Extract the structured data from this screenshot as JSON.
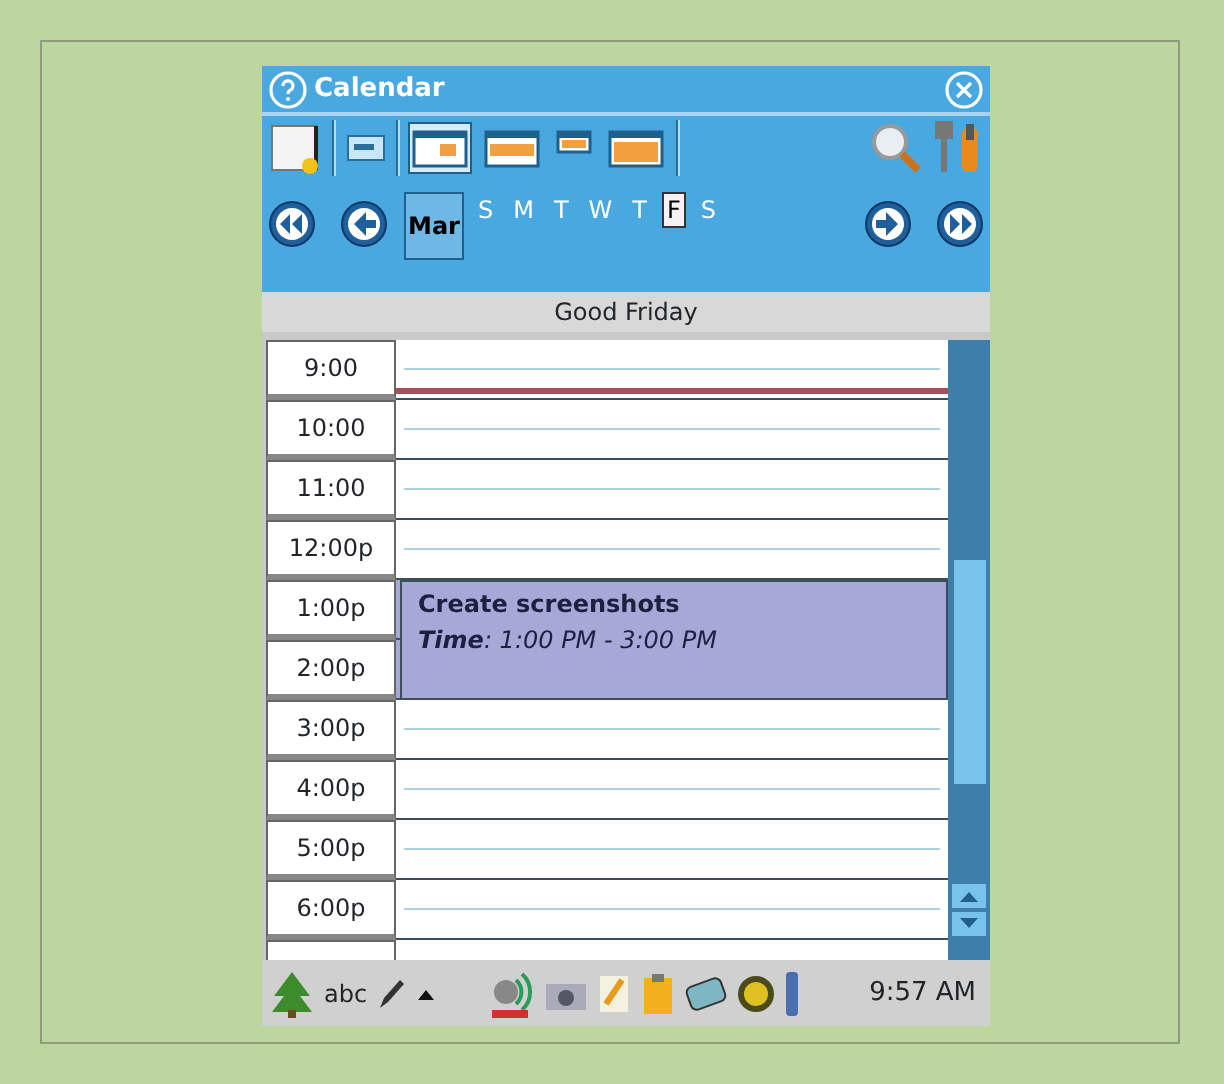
{
  "window": {
    "title": "Calendar"
  },
  "view_buttons": [
    {
      "selected": true
    },
    {
      "selected": false
    },
    {
      "selected": false
    },
    {
      "selected": false
    }
  ],
  "nav": {
    "month": {
      "label": "Mar",
      "selected": true
    },
    "days": [
      {
        "label": "S",
        "selected": false
      },
      {
        "label": "M",
        "selected": false
      },
      {
        "label": "T",
        "selected": false
      },
      {
        "label": "W",
        "selected": false
      },
      {
        "label": "T",
        "selected": false
      },
      {
        "label": "F",
        "selected": true
      },
      {
        "label": "S",
        "selected": false
      }
    ]
  },
  "day_header": "Good Friday",
  "hours": [
    {
      "label": "9:00",
      "busy": false,
      "current_time": true
    },
    {
      "label": "10:00",
      "busy": false,
      "current_time": false
    },
    {
      "label": "11:00",
      "busy": false,
      "current_time": false
    },
    {
      "label": "12:00p",
      "busy": false,
      "current_time": false
    },
    {
      "label": "1:00p",
      "busy": true,
      "current_time": false,
      "event": {
        "title": "Create screenshots",
        "time": "**Time**: 1:00 PM - 3:00 PM"
      }
    },
    {
      "label": "2:00p",
      "busy": true,
      "current_time": false
    },
    {
      "label": "3:00p",
      "busy": false,
      "current_time": false
    },
    {
      "label": "4:00p",
      "busy": false,
      "current_time": false
    },
    {
      "label": "5:00p",
      "busy": false,
      "current_time": false
    },
    {
      "label": "6:00p",
      "busy": false,
      "current_time": false
    }
  ],
  "taskbar": {
    "input_label": "abc",
    "clock": "9:57 AM"
  }
}
